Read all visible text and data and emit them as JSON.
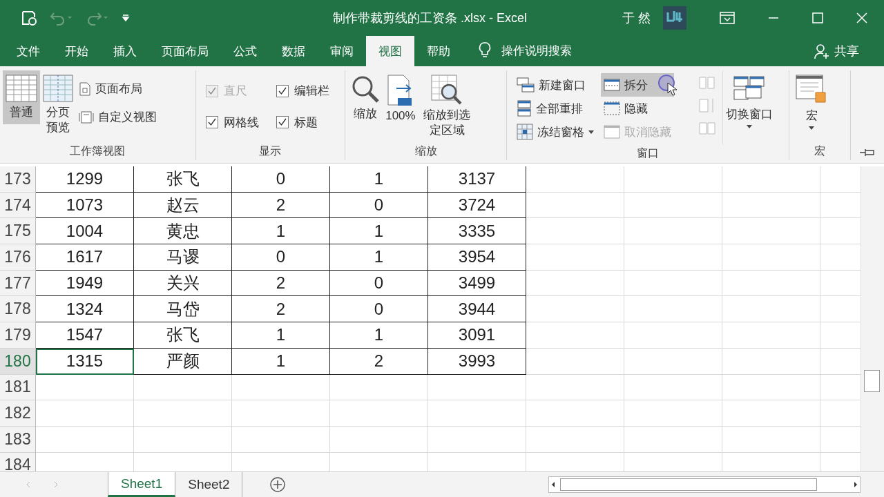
{
  "title_bar": {
    "title": "制作带裁剪线的工资条 .xlsx  -  Excel",
    "user": "于 然"
  },
  "menu_tabs": [
    {
      "label": "文件",
      "selected": false
    },
    {
      "label": "开始",
      "selected": false
    },
    {
      "label": "插入",
      "selected": false
    },
    {
      "label": "页面布局",
      "selected": false
    },
    {
      "label": "公式",
      "selected": false
    },
    {
      "label": "数据",
      "selected": false
    },
    {
      "label": "审阅",
      "selected": false
    },
    {
      "label": "视图",
      "selected": true
    },
    {
      "label": "帮助",
      "selected": false
    }
  ],
  "tell_me": "操作说明搜索",
  "share": "共享",
  "ribbon": {
    "workbook_views": {
      "label": "工作簿视图",
      "large": [
        {
          "label": "普通",
          "selected": true
        },
        {
          "label": "分页预览",
          "selected": false
        }
      ],
      "small": [
        {
          "label": "页面布局"
        },
        {
          "label": "自定义视图"
        }
      ]
    },
    "show": {
      "label": "显示",
      "checkboxes": [
        {
          "label": "直尺",
          "checked": true,
          "disabled": true
        },
        {
          "label": "编辑栏",
          "checked": true,
          "disabled": false
        },
        {
          "label": "网格线",
          "checked": true,
          "disabled": false
        },
        {
          "label": "标题",
          "checked": true,
          "disabled": false
        }
      ]
    },
    "zoom": {
      "label": "缩放",
      "buttons": [
        {
          "label": "缩放"
        },
        {
          "label": "100%"
        },
        {
          "label": "缩放到选定区域"
        }
      ]
    },
    "window": {
      "label": "窗口",
      "small": [
        {
          "label": "新建窗口",
          "highlighted": false,
          "disabled": false,
          "dropdown": false
        },
        {
          "label": "全部重排",
          "highlighted": false,
          "disabled": false,
          "dropdown": false
        },
        {
          "label": "冻结窗格",
          "highlighted": false,
          "disabled": false,
          "dropdown": true
        },
        {
          "label": "拆分",
          "highlighted": true,
          "disabled": false,
          "dropdown": false
        },
        {
          "label": "隐藏",
          "highlighted": false,
          "disabled": false,
          "dropdown": false
        },
        {
          "label": "取消隐藏",
          "highlighted": false,
          "disabled": true,
          "dropdown": false
        }
      ],
      "switch": {
        "label": "切换窗口"
      }
    },
    "macros": {
      "label": "宏",
      "button": {
        "label": "宏"
      }
    }
  },
  "sheet": {
    "rows": [
      {
        "header": "173",
        "selected": false,
        "cells": [
          {
            "text": "1299",
            "selected": false
          },
          {
            "text": "张飞",
            "selected": false
          },
          {
            "text": "0",
            "selected": false
          },
          {
            "text": "1",
            "selected": false
          },
          {
            "text": "3137",
            "selected": false
          }
        ]
      },
      {
        "header": "174",
        "selected": false,
        "cells": [
          {
            "text": "1073",
            "selected": false
          },
          {
            "text": "赵云",
            "selected": false
          },
          {
            "text": "2",
            "selected": false
          },
          {
            "text": "0",
            "selected": false
          },
          {
            "text": "3724",
            "selected": false
          }
        ]
      },
      {
        "header": "175",
        "selected": false,
        "cells": [
          {
            "text": "1004",
            "selected": false
          },
          {
            "text": "黄忠",
            "selected": false
          },
          {
            "text": "1",
            "selected": false
          },
          {
            "text": "1",
            "selected": false
          },
          {
            "text": "3335",
            "selected": false
          }
        ]
      },
      {
        "header": "176",
        "selected": false,
        "cells": [
          {
            "text": "1617",
            "selected": false
          },
          {
            "text": "马谡",
            "selected": false
          },
          {
            "text": "0",
            "selected": false
          },
          {
            "text": "1",
            "selected": false
          },
          {
            "text": "3954",
            "selected": false
          }
        ]
      },
      {
        "header": "177",
        "selected": false,
        "cells": [
          {
            "text": "1949",
            "selected": false
          },
          {
            "text": "关兴",
            "selected": false
          },
          {
            "text": "2",
            "selected": false
          },
          {
            "text": "0",
            "selected": false
          },
          {
            "text": "3499",
            "selected": false
          }
        ]
      },
      {
        "header": "178",
        "selected": false,
        "cells": [
          {
            "text": "1324",
            "selected": false
          },
          {
            "text": "马岱",
            "selected": false
          },
          {
            "text": "2",
            "selected": false
          },
          {
            "text": "0",
            "selected": false
          },
          {
            "text": "3944",
            "selected": false
          }
        ]
      },
      {
        "header": "179",
        "selected": false,
        "cells": [
          {
            "text": "1547",
            "selected": false
          },
          {
            "text": "张飞",
            "selected": false
          },
          {
            "text": "1",
            "selected": false
          },
          {
            "text": "1",
            "selected": false
          },
          {
            "text": "3091",
            "selected": false
          }
        ]
      },
      {
        "header": "180",
        "selected": true,
        "cells": [
          {
            "text": "1315",
            "selected": true
          },
          {
            "text": "严颜",
            "selected": false
          },
          {
            "text": "1",
            "selected": false
          },
          {
            "text": "2",
            "selected": false
          },
          {
            "text": "3993",
            "selected": false
          }
        ]
      },
      {
        "header": "181",
        "selected": false
      },
      {
        "header": "182",
        "selected": false
      },
      {
        "header": "183",
        "selected": false
      },
      {
        "header": "184",
        "selected": false
      }
    ]
  },
  "sheet_tabs": [
    {
      "label": "Sheet1",
      "selected": true
    },
    {
      "label": "Sheet2",
      "selected": false
    }
  ]
}
